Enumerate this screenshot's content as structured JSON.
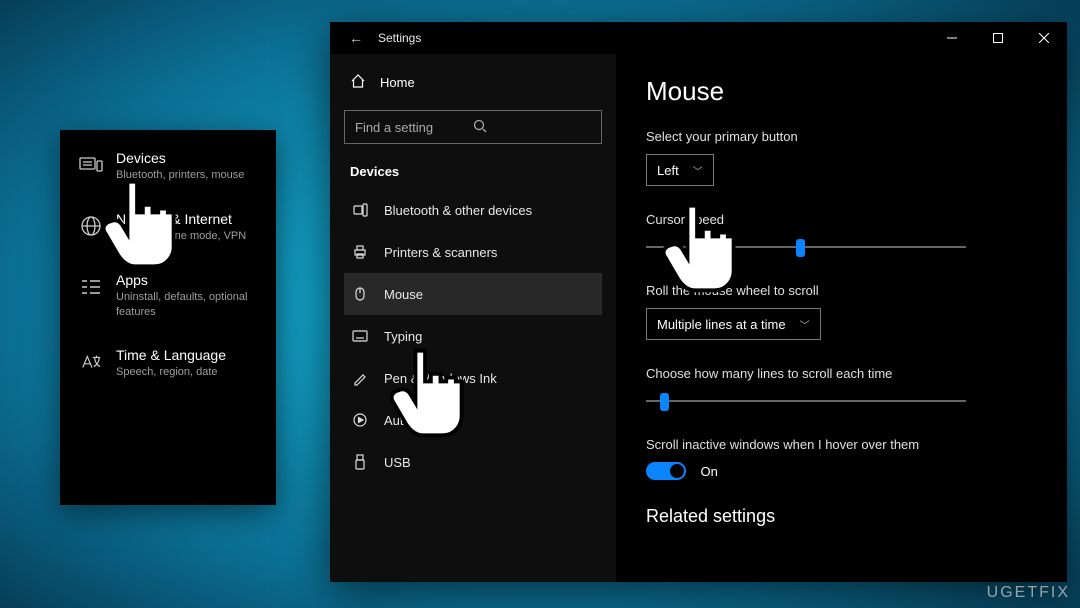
{
  "tile": {
    "items": [
      {
        "title": "Devices",
        "sub": "Bluetooth, printers, mouse"
      },
      {
        "title": "Network & Internet",
        "sub": "Wi-Fi, airplane mode, VPN"
      },
      {
        "title": "Apps",
        "sub": "Uninstall, defaults, optional features"
      },
      {
        "title": "Time & Language",
        "sub": "Speech, region, date"
      }
    ]
  },
  "window": {
    "title": "Settings",
    "home_label": "Home",
    "search_placeholder": "Find a setting",
    "section_label": "Devices",
    "nav": [
      {
        "label": "Bluetooth & other devices"
      },
      {
        "label": "Printers & scanners"
      },
      {
        "label": "Mouse"
      },
      {
        "label": "Typing"
      },
      {
        "label": "Pen & Windows Ink"
      },
      {
        "label": "AutoPlay"
      },
      {
        "label": "USB"
      }
    ]
  },
  "content": {
    "heading": "Mouse",
    "primary_button_label": "Select your primary button",
    "primary_button_value": "Left",
    "cursor_speed_label": "Cursor speed",
    "roll_label": "Roll the mouse wheel to scroll",
    "roll_value": "Multiple lines at a time",
    "lines_label": "Choose how many lines to scroll each time",
    "hover_label": "Scroll inactive windows when I hover over them",
    "hover_value": "On",
    "related_heading": "Related settings"
  },
  "watermark": "UGETFIX"
}
